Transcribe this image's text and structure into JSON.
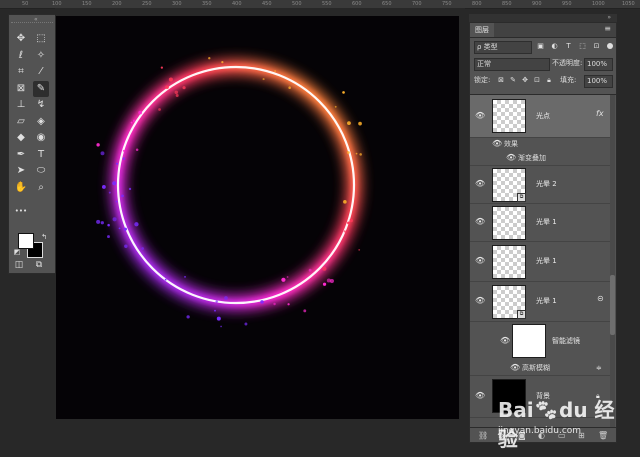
{
  "ruler": {
    "ticks": [
      "50",
      "100",
      "150",
      "200",
      "250",
      "300",
      "350",
      "400",
      "450",
      "500",
      "550",
      "600",
      "650",
      "700",
      "750",
      "800",
      "850",
      "900",
      "950",
      "1000",
      "1050"
    ]
  },
  "toolbar": {
    "collapse": "«",
    "tools": [
      {
        "name": "move-tool-icon",
        "glyph": "✥"
      },
      {
        "name": "marquee-tool-icon",
        "glyph": "⬚"
      },
      {
        "name": "lasso-tool-icon",
        "glyph": "ℓ"
      },
      {
        "name": "quick-select-tool-icon",
        "glyph": "✧"
      },
      {
        "name": "crop-tool-icon",
        "glyph": "⌗"
      },
      {
        "name": "eyedropper-tool-icon",
        "glyph": "⁄"
      },
      {
        "name": "frame-tool-icon",
        "glyph": "⊠"
      },
      {
        "name": "brush-tool-icon",
        "glyph": "✎"
      },
      {
        "name": "stamp-tool-icon",
        "glyph": "⊥"
      },
      {
        "name": "history-brush-tool-icon",
        "glyph": "↯"
      },
      {
        "name": "eraser-tool-icon",
        "glyph": "▱"
      },
      {
        "name": "paint-bucket-tool-icon",
        "glyph": "◈"
      },
      {
        "name": "blur-tool-icon",
        "glyph": "◆"
      },
      {
        "name": "dodge-tool-icon",
        "glyph": "◉"
      },
      {
        "name": "pen-tool-icon",
        "glyph": "✒"
      },
      {
        "name": "type-tool-icon",
        "glyph": "T"
      },
      {
        "name": "path-select-tool-icon",
        "glyph": "➤"
      },
      {
        "name": "shape-tool-icon",
        "glyph": "⬭"
      },
      {
        "name": "hand-tool-icon",
        "glyph": "✋"
      },
      {
        "name": "zoom-tool-icon",
        "glyph": "⌕"
      },
      {
        "name": "more-tools-icon",
        "glyph": "•••"
      }
    ],
    "foreground_color": "#ffffff",
    "background_color": "#000000"
  },
  "panel": {
    "arrows": "»",
    "tab_label": "图层",
    "menu_glyph": "≡",
    "filter_kind": "ρ 类型",
    "blend_mode": "正常",
    "opacity_label": "不透明度:",
    "opacity_value": "100%",
    "lock_label": "锁定:",
    "fill_label": "填充:",
    "fill_value": "100%"
  },
  "layers": [
    {
      "name": "光点",
      "thumb": "checker",
      "smart": false,
      "fx": "fx",
      "selected": true
    },
    {
      "name": "光晕 2",
      "thumb": "checker",
      "smart": true
    },
    {
      "name": "光晕 1",
      "thumb": "checker",
      "smart": false
    },
    {
      "name": "光晕 1",
      "thumb": "checker",
      "smart": false
    },
    {
      "name": "光晕 1",
      "thumb": "checker",
      "smart": true
    }
  ],
  "effects": {
    "label": "效果",
    "item": "渐变叠加"
  },
  "smart_filters": {
    "label": "智能滤镜",
    "item": "高斯模糊"
  },
  "background_layer": {
    "name": "背景"
  },
  "watermark": {
    "brand_a": "Bai",
    "brand_b": "du",
    "brand_c": "经验",
    "url": "jingyan.baidu.com"
  },
  "colors": {
    "ring_gradient": [
      "#7a2cff",
      "#ff2bd0",
      "#ff3a5a",
      "#ffb02a",
      "#ffffff"
    ],
    "canvas_bg": "#050306"
  }
}
